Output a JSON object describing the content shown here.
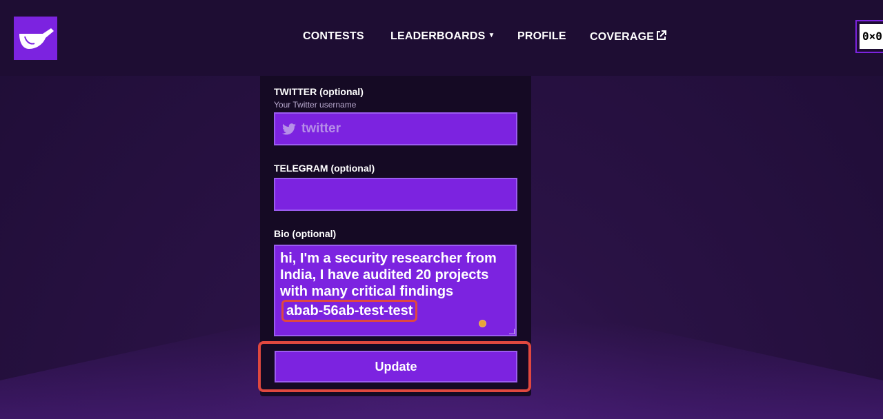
{
  "nav": {
    "contests": "CONTESTS",
    "leaderboards": "LEADERBOARDS",
    "profile": "PROFILE",
    "coverage": "COVERAGE"
  },
  "wallet": {
    "address": "0×0"
  },
  "form": {
    "twitter": {
      "label": "TWITTER (optional)",
      "hint": "Your Twitter username",
      "placeholder": "twitter",
      "icon": "twitter-icon"
    },
    "telegram": {
      "label": "TELEGRAM (optional)",
      "value": ""
    },
    "bio": {
      "label": "Bio (optional)",
      "text": "hi, I'm a security researcher from India, I have audited 20 projects with many critical findings",
      "highlighted": "abab-56ab-test-test"
    },
    "update_label": "Update"
  },
  "colors": {
    "accent": "#7c23e0",
    "annotation": "#e0483f",
    "background": "#1e0d33"
  }
}
